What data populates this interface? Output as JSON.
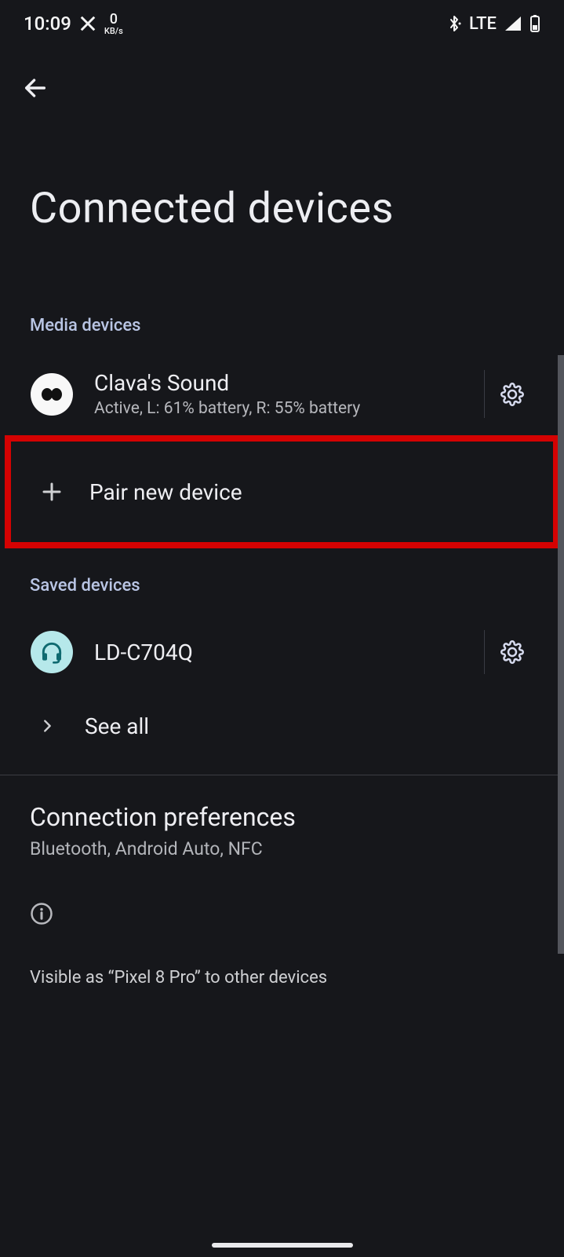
{
  "statusbar": {
    "time": "10:09",
    "app_indicator": "X",
    "kbs_value": "0",
    "kbs_label": "KB/s",
    "network_label": "LTE"
  },
  "page": {
    "title": "Connected devices"
  },
  "sections": {
    "media": {
      "label": "Media devices"
    },
    "saved": {
      "label": "Saved devices"
    }
  },
  "media_device": {
    "name": "Clava's Sound",
    "status": "Active, L: 61% battery, R: 55% battery"
  },
  "pair": {
    "label": "Pair new device"
  },
  "saved_device": {
    "name": "LD-C704Q"
  },
  "see_all": {
    "label": "See all"
  },
  "prefs": {
    "title": "Connection preferences",
    "subtitle": "Bluetooth, Android Auto, NFC"
  },
  "visibility": {
    "text": "Visible as “Pixel 8 Pro” to other devices"
  }
}
